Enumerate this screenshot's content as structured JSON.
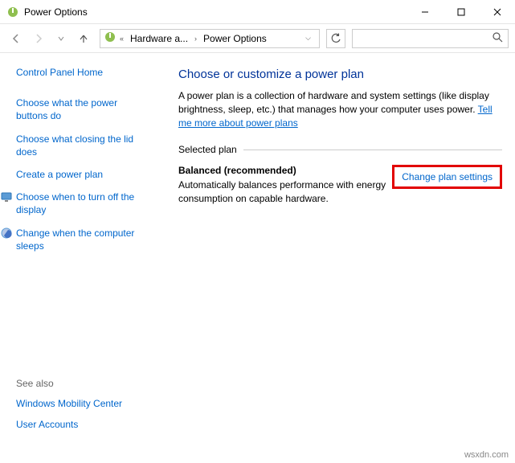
{
  "window": {
    "title": "Power Options"
  },
  "breadcrumb": {
    "item1": "Hardware a...",
    "item2": "Power Options"
  },
  "search": {
    "placeholder": ""
  },
  "sidebar": {
    "home": "Control Panel Home",
    "links": [
      "Choose what the power buttons do",
      "Choose what closing the lid does",
      "Create a power plan",
      "Choose when to turn off the display",
      "Change when the computer sleeps"
    ],
    "seealso_hdr": "See also",
    "seealso": [
      "Windows Mobility Center",
      "User Accounts"
    ]
  },
  "main": {
    "heading": "Choose or customize a power plan",
    "description": "A power plan is a collection of hardware and system settings (like display brightness, sleep, etc.) that manages how your computer uses power. ",
    "tell_more": "Tell me more about power plans",
    "selected_label": "Selected plan",
    "plan_name": "Balanced (recommended)",
    "plan_desc": "Automatically balances performance with energy consumption on capable hardware.",
    "change_link": "Change plan settings"
  },
  "watermark": "wsxdn.com"
}
